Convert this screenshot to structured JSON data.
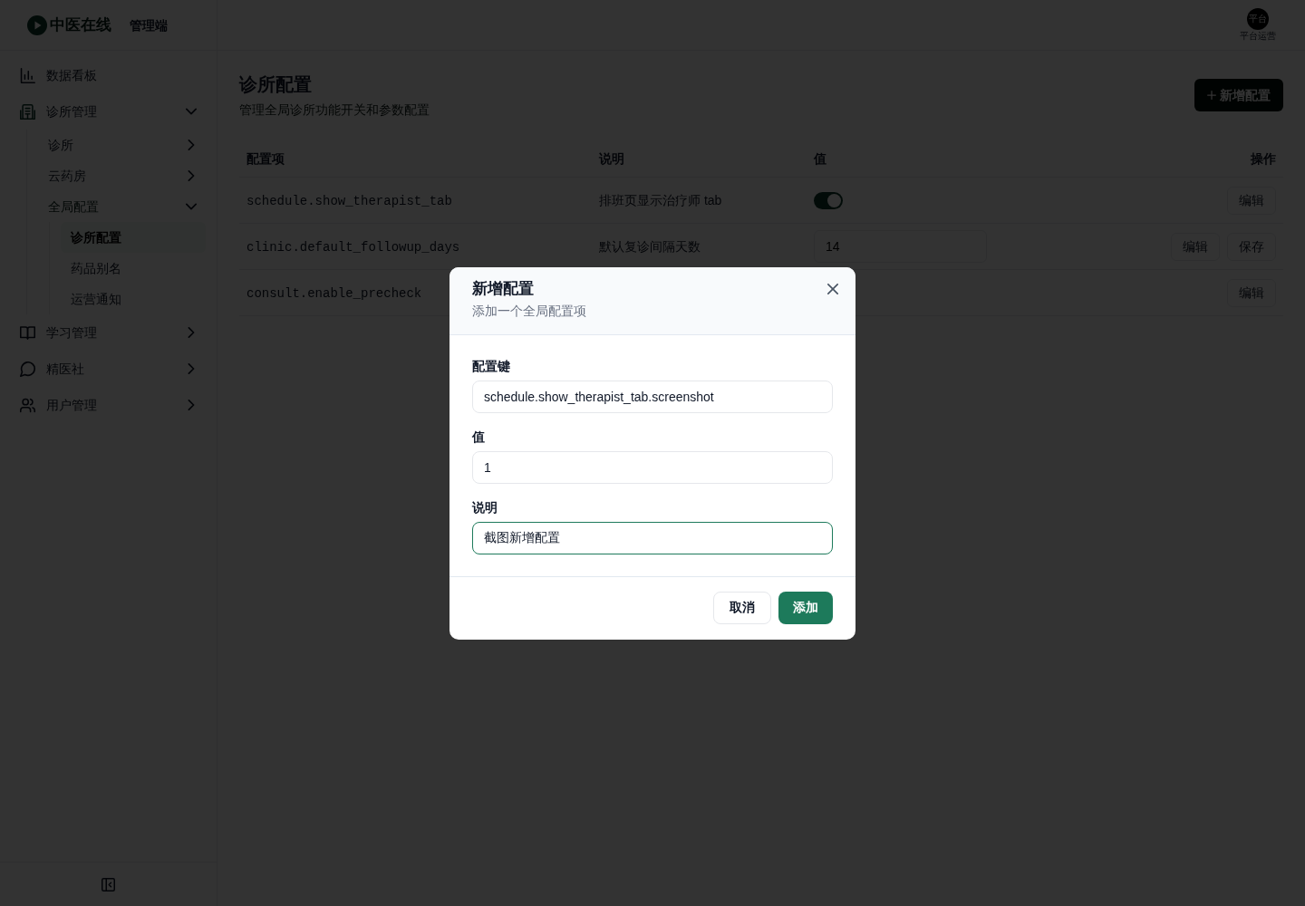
{
  "brand": {
    "name": "中医在线",
    "tag": "管理端"
  },
  "user": {
    "avatar_text": "平台",
    "role": "平台运营"
  },
  "sidebar": {
    "items": [
      {
        "label": "数据看板",
        "selected": false
      },
      {
        "label": "诊所管理",
        "selected": false,
        "expanded": true,
        "children": [
          {
            "label": "诊所",
            "selected": false,
            "expanded": false
          },
          {
            "label": "云药房",
            "selected": false,
            "expanded": false
          },
          {
            "label": "全局配置",
            "selected": false,
            "expanded": true,
            "children": [
              {
                "label": "诊所配置",
                "selected": true
              },
              {
                "label": "药品别名",
                "selected": false
              },
              {
                "label": "运营通知",
                "selected": false
              }
            ]
          }
        ]
      },
      {
        "label": "学习管理",
        "selected": false,
        "expanded": false
      },
      {
        "label": "精医社",
        "selected": false,
        "expanded": false
      },
      {
        "label": "用户管理",
        "selected": false,
        "expanded": false
      }
    ]
  },
  "page": {
    "title": "诊所配置",
    "subtitle": "管理全局诊所功能开关和参数配置",
    "add_button": "新增配置"
  },
  "table": {
    "columns": [
      "配置项",
      "说明",
      "值",
      "操作"
    ],
    "rows": [
      {
        "key": "schedule.show_therapist_tab",
        "description": "排班页显示治疗师 tab",
        "value": {
          "kind": "toggle",
          "on": true
        },
        "actions": [
          "编辑"
        ]
      },
      {
        "key": "clinic.default_followup_days",
        "description": "默认复诊间隔天数",
        "value": {
          "kind": "input",
          "value": "14"
        },
        "actions": [
          "编辑",
          "保存"
        ]
      },
      {
        "key": "consult.enable_precheck",
        "actions": [
          "编辑"
        ]
      }
    ]
  },
  "dialog": {
    "title": "新增配置",
    "subtitle": "添加一个全局配置项",
    "fields": [
      {
        "label": "配置键",
        "value": "schedule.show_therapist_tab.screenshot",
        "focused": false
      },
      {
        "label": "值",
        "value": "1",
        "focused": false
      },
      {
        "label": "说明",
        "value": "截图新增配置",
        "focused": true
      }
    ],
    "buttons": [
      {
        "label": "取消",
        "kind": "secondary"
      },
      {
        "label": "添加",
        "kind": "primary"
      }
    ]
  }
}
